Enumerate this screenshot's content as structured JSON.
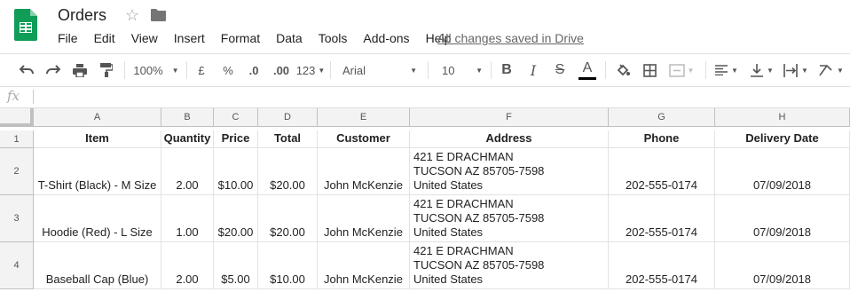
{
  "app": {
    "doc_title": "Orders",
    "menu": [
      "File",
      "Edit",
      "View",
      "Insert",
      "Format",
      "Data",
      "Tools",
      "Add-ons",
      "Help"
    ],
    "save_status": "All changes saved in Drive"
  },
  "toolbar": {
    "zoom": "100%",
    "currency": "£",
    "percent": "%",
    "dec_decrease": ".0",
    "dec_increase": ".00",
    "more_formats": "123",
    "font": "Arial",
    "font_size": "10"
  },
  "formula_bar": {
    "fx_label": "fx",
    "value": ""
  },
  "columns": [
    "A",
    "B",
    "C",
    "D",
    "E",
    "F",
    "G",
    "H"
  ],
  "row_numbers": [
    "1",
    "2",
    "3",
    "4"
  ],
  "headers": [
    "Item",
    "Quantity",
    "Price",
    "Total",
    "Customer",
    "Address",
    "Phone",
    "Delivery Date"
  ],
  "rows": [
    {
      "item": "T-Shirt (Black) - M Size",
      "quantity": "2.00",
      "price": "$10.00",
      "total": "$20.00",
      "customer": "John McKenzie",
      "address": [
        "421 E DRACHMAN",
        "TUCSON AZ 85705-7598",
        "United States"
      ],
      "phone": "202-555-0174",
      "date": "07/09/2018"
    },
    {
      "item": "Hoodie (Red) - L Size",
      "quantity": "1.00",
      "price": "$20.00",
      "total": "$20.00",
      "customer": "John McKenzie",
      "address": [
        "421 E DRACHMAN",
        "TUCSON AZ 85705-7598",
        "United States"
      ],
      "phone": "202-555-0174",
      "date": "07/09/2018"
    },
    {
      "item": "Baseball Cap (Blue)",
      "quantity": "2.00",
      "price": "$5.00",
      "total": "$10.00",
      "customer": "John McKenzie",
      "address": [
        "421 E DRACHMAN",
        "TUCSON AZ 85705-7598",
        "United States"
      ],
      "phone": "202-555-0174",
      "date": "07/09/2018"
    }
  ]
}
